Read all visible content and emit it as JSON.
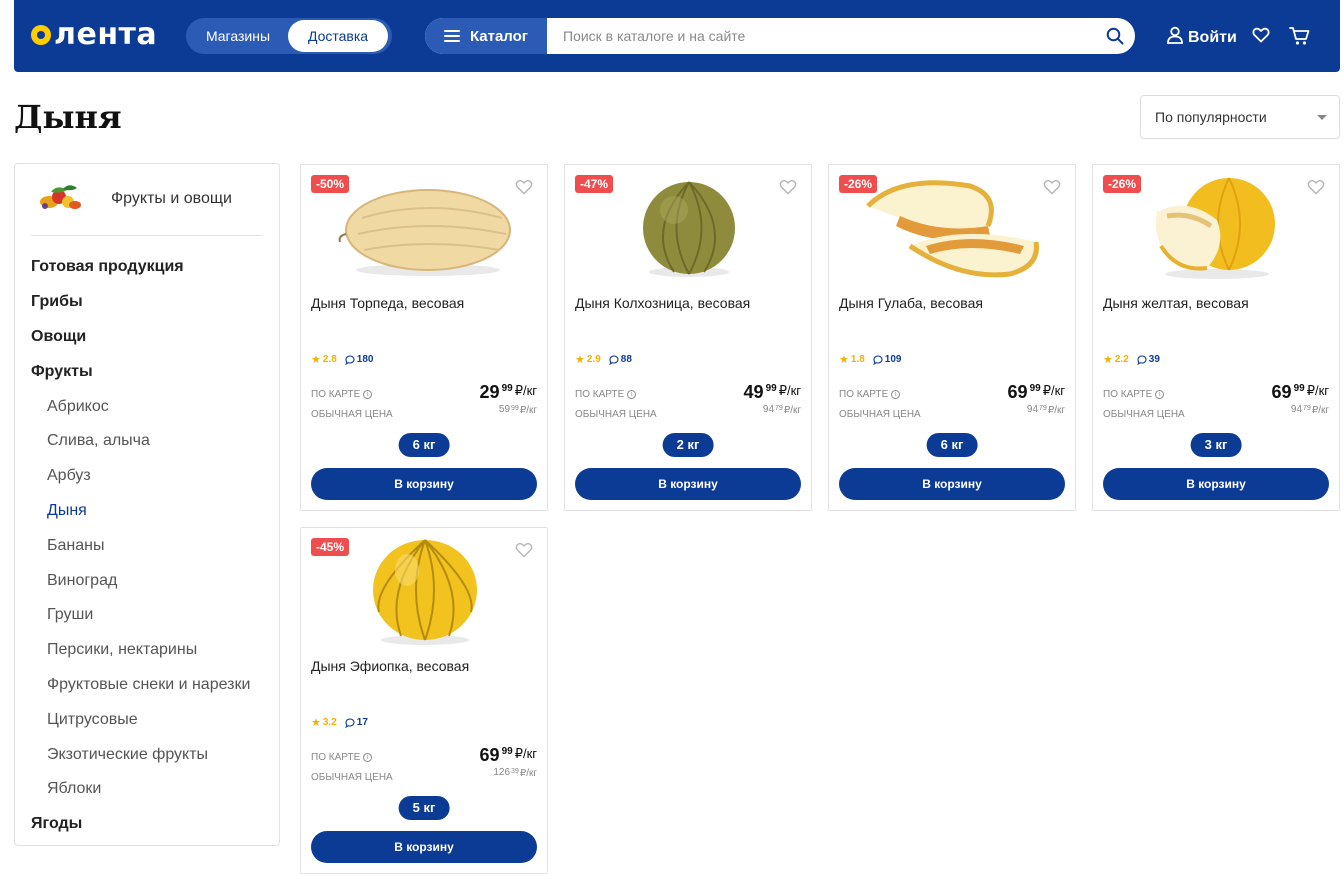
{
  "header": {
    "logo_text": "лента",
    "mode_stores": "Магазины",
    "mode_delivery": "Доставка",
    "catalog_label": "Каталог",
    "search_placeholder": "Поиск в каталоге и на сайте",
    "login_label": "Войти",
    "brand_color": "#0c3b95",
    "accent_color": "#ffcc00"
  },
  "page": {
    "title": "Дыня",
    "sort_value": "По популярности"
  },
  "sidebar": {
    "category": "Фрукты и овощи",
    "items": [
      {
        "label": "Готовая продукция",
        "level": "top"
      },
      {
        "label": "Грибы",
        "level": "top"
      },
      {
        "label": "Овощи",
        "level": "top"
      },
      {
        "label": "Фрукты",
        "level": "top"
      },
      {
        "label": "Абрикос",
        "level": "sub"
      },
      {
        "label": "Слива, алыча",
        "level": "sub"
      },
      {
        "label": "Арбуз",
        "level": "sub"
      },
      {
        "label": "Дыня",
        "level": "sub",
        "active": true
      },
      {
        "label": "Бананы",
        "level": "sub"
      },
      {
        "label": "Виноград",
        "level": "sub"
      },
      {
        "label": "Груши",
        "level": "sub"
      },
      {
        "label": "Персики, нектарины",
        "level": "sub"
      },
      {
        "label": "Фруктовые снеки и нарезки",
        "level": "sub"
      },
      {
        "label": "Цитрусовые",
        "level": "sub"
      },
      {
        "label": "Экзотические фрукты",
        "level": "sub"
      },
      {
        "label": "Яблоки",
        "level": "sub"
      },
      {
        "label": "Ягоды",
        "level": "top"
      }
    ]
  },
  "labels": {
    "by_card": "ПО КАРТЕ",
    "regular_price": "ОБЫЧНАЯ ЦЕНА",
    "add_to_cart": "В корзину",
    "currency_unit": "₽/кг"
  },
  "products": [
    {
      "discount": "-50%",
      "name": "Дыня Торпеда, весовая",
      "rating": "2.8",
      "comments": "180",
      "price_int": "29",
      "price_frac": "99",
      "old_int": "59",
      "old_frac": "99",
      "weight": "6 кг",
      "image": "torpedo-melon"
    },
    {
      "discount": "-47%",
      "name": "Дыня Колхозница, весовая",
      "rating": "2.9",
      "comments": "88",
      "price_int": "49",
      "price_frac": "99",
      "old_int": "94",
      "old_frac": "79",
      "weight": "2 кг",
      "image": "round-green-melon"
    },
    {
      "discount": "-26%",
      "name": "Дыня Гулаба, весовая",
      "rating": "1.8",
      "comments": "109",
      "price_int": "69",
      "price_frac": "99",
      "old_int": "94",
      "old_frac": "79",
      "weight": "6 кг",
      "image": "sliced-melon"
    },
    {
      "discount": "-26%",
      "name": "Дыня желтая, весовая",
      "rating": "2.2",
      "comments": "39",
      "price_int": "69",
      "price_frac": "99",
      "old_int": "94",
      "old_frac": "79",
      "weight": "3 кг",
      "image": "yellow-melon-slice"
    },
    {
      "discount": "-45%",
      "name": "Дыня Эфиопка, весовая",
      "rating": "3.2",
      "comments": "17",
      "price_int": "69",
      "price_frac": "99",
      "old_int": "126",
      "old_frac": "39",
      "weight": "5 кг",
      "image": "ribbed-yellow-melon"
    }
  ]
}
